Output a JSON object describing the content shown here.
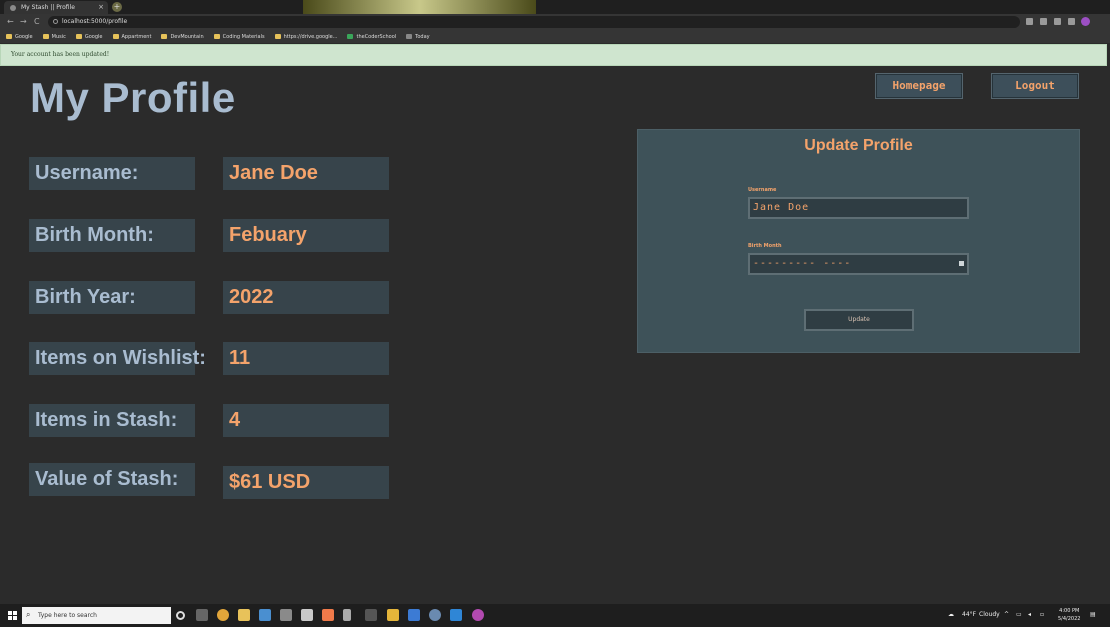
{
  "browser": {
    "tab_title": "My Stash || Profile",
    "tab_close": "×",
    "new_tab": "+",
    "url": "localhost:5000/profile",
    "back": "←",
    "forward": "→",
    "reload": "C",
    "bookmarks": [
      "Google",
      "Music",
      "Google",
      "Appartment",
      "DevMountain",
      "Coding Materials",
      "https://drive.google...",
      "theCoderSchool",
      "Today"
    ]
  },
  "flash": {
    "message": "Your account has been updated!"
  },
  "page": {
    "title": "My Profile",
    "homepage_button": "Homepage",
    "logout_button": "Logout"
  },
  "profile": {
    "username_label": "Username:",
    "username_value": "Jane Doe",
    "birth_month_label": "Birth Month:",
    "birth_month_value": "Febuary",
    "birth_year_label": "Birth Year:",
    "birth_year_value": "2022",
    "wishlist_label": "Items on Wishlist:",
    "wishlist_value": "11",
    "stash_label": "Items in Stash:",
    "stash_value": "4",
    "value_label": "Value of Stash:",
    "value_value": "$61 USD"
  },
  "update_form": {
    "title": "Update Profile",
    "username_label": "Username",
    "username_value": "Jane Doe",
    "birth_month_label": "Birth Month",
    "birth_month_value": "--------- ----",
    "submit_label": "Update"
  },
  "taskbar": {
    "search_placeholder": "Type here to search",
    "weather_temp": "44°F",
    "weather_text": "Cloudy",
    "time": "4:00 PM",
    "date": "5/4/2022"
  },
  "colors": {
    "accent": "#f4a36b",
    "label_text": "#a9bcd0",
    "panel_bg": "#3e5259",
    "page_bg": "#2b2b2b"
  }
}
